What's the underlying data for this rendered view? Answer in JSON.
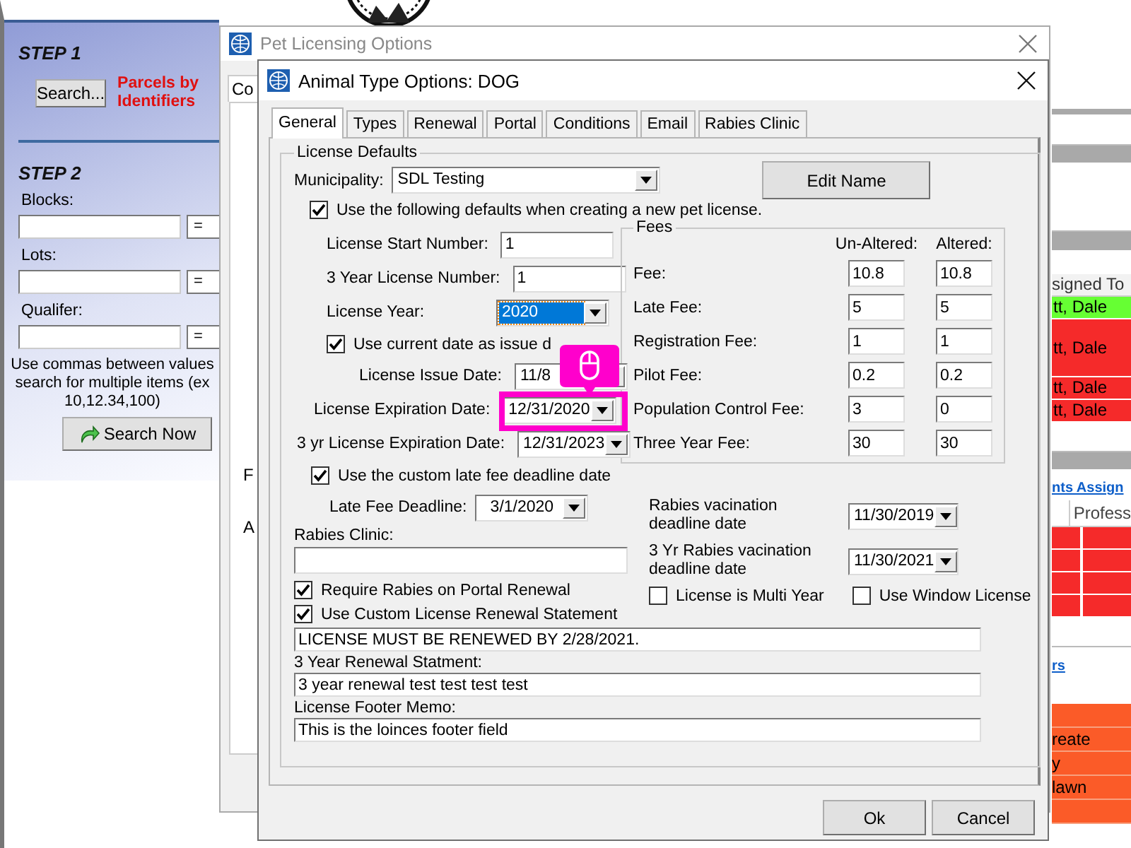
{
  "map_search": {
    "step1": "STEP 1",
    "search_button": "Search...",
    "parcels_label": "Parcels by Identifiers",
    "step2": "STEP 2",
    "fields": [
      {
        "label": "Blocks:",
        "operator": "="
      },
      {
        "label": "Lots:",
        "operator": "="
      },
      {
        "label": "Qualifer:",
        "operator": "="
      }
    ],
    "help_lines": [
      "Use commas between values",
      "search for multiple items (ex",
      "10,12.34,100)"
    ],
    "search_now_button": "Search Now"
  },
  "right_panel": {
    "column_header": "signed To",
    "assignees": [
      {
        "text": "tt, Dale",
        "color": "#66ff33"
      },
      {
        "text": "tt, Dale",
        "color": "#f52a2a"
      },
      {
        "text": "tt, Dale",
        "color": "#f52a2a"
      },
      {
        "text": "tt, Dale",
        "color": "#f52a2a"
      }
    ],
    "section_link": "nts Assign",
    "column_2_header": "Profess",
    "section_link_2": "rs",
    "items": [
      "reate",
      "y",
      "lawn"
    ]
  },
  "pet_window": {
    "title": "Pet Licensing Options",
    "tab": "Co",
    "fragments": [
      "F",
      "A"
    ]
  },
  "dialog": {
    "title": "Animal Type Options: DOG",
    "tabs": [
      {
        "label": "General",
        "selected": true
      },
      {
        "label": "Types",
        "selected": false
      },
      {
        "label": "Renewal",
        "selected": false
      },
      {
        "label": "Portal",
        "selected": false
      },
      {
        "label": "Conditions",
        "selected": false
      },
      {
        "label": "Email",
        "selected": false
      },
      {
        "label": "Rabies Clinic",
        "selected": false
      }
    ],
    "group_title": "License Defaults",
    "municipality": {
      "label": "Municipality:",
      "value": "SDL Testing"
    },
    "edit_button": "Edit Name",
    "use_defaults": {
      "label": "Use the following defaults when creating a new pet license.",
      "checked": true
    },
    "license_start": {
      "label": "License Start Number:",
      "value": "1"
    },
    "three_year_number": {
      "label": "3 Year License Number:",
      "value": "1"
    },
    "license_year": {
      "label": "License Year:",
      "value": "2020",
      "focused": true
    },
    "use_current_date": {
      "label": "Use current date as issue d",
      "checked": true
    },
    "issue_date": {
      "label": "License Issue Date:",
      "value": "11/8"
    },
    "expiration": {
      "label": "License Expiration Date:",
      "value": "12/31/2020",
      "highlighted": true
    },
    "three_year_expiration": {
      "label": "3 yr License Expiration Date:",
      "value": "12/31/2023"
    },
    "custom_late_fee": {
      "label": "Use the custom late fee deadline date",
      "checked": true
    },
    "late_fee_deadline": {
      "label": "Late Fee Deadline:",
      "value": "3/1/2020"
    },
    "rabies_clinic_label": "Rabies Clinic:",
    "require_rabies": {
      "label": "Require Rabies on Portal Renewal",
      "checked": true
    },
    "custom_statement": {
      "label": "Use Custom License Renewal Statement",
      "checked": true
    },
    "fees": {
      "title": "Fees",
      "columns": [
        "Un-Altered:",
        "Altered:"
      ],
      "rows": [
        {
          "label": "Fee:",
          "unaltered": "10.8",
          "altered": "10.8"
        },
        {
          "label": "Late Fee:",
          "unaltered": "5",
          "altered": "5"
        },
        {
          "label": "Registration Fee:",
          "unaltered": "1",
          "altered": "1"
        },
        {
          "label": "Pilot Fee:",
          "unaltered": "0.2",
          "altered": "0.2"
        },
        {
          "label": "Population Control Fee:",
          "unaltered": "3",
          "altered": "0"
        },
        {
          "label": "Three Year Fee:",
          "unaltered": "30",
          "altered": "30"
        }
      ]
    },
    "rabies_deadline": {
      "label": "Rabies vacination deadline date",
      "value": "11/30/2019"
    },
    "three_year_rabies": {
      "label": "3 Yr Rabies vacination deadline date",
      "value": "11/30/2021"
    },
    "multi_year": {
      "label": "License is Multi Year",
      "checked": false
    },
    "window_license": {
      "label": "Use Window License",
      "checked": false
    },
    "statement": "LICENSE MUST BE RENEWED BY 2/28/2021.",
    "three_year_statement_label": "3 Year Renewal Statment:",
    "three_year_statement": "3 year renewal test test test test",
    "footer_label": "License Footer Memo:",
    "footer": "This is the loinces footer field",
    "buttons": [
      "Ok",
      "Cancel"
    ]
  }
}
